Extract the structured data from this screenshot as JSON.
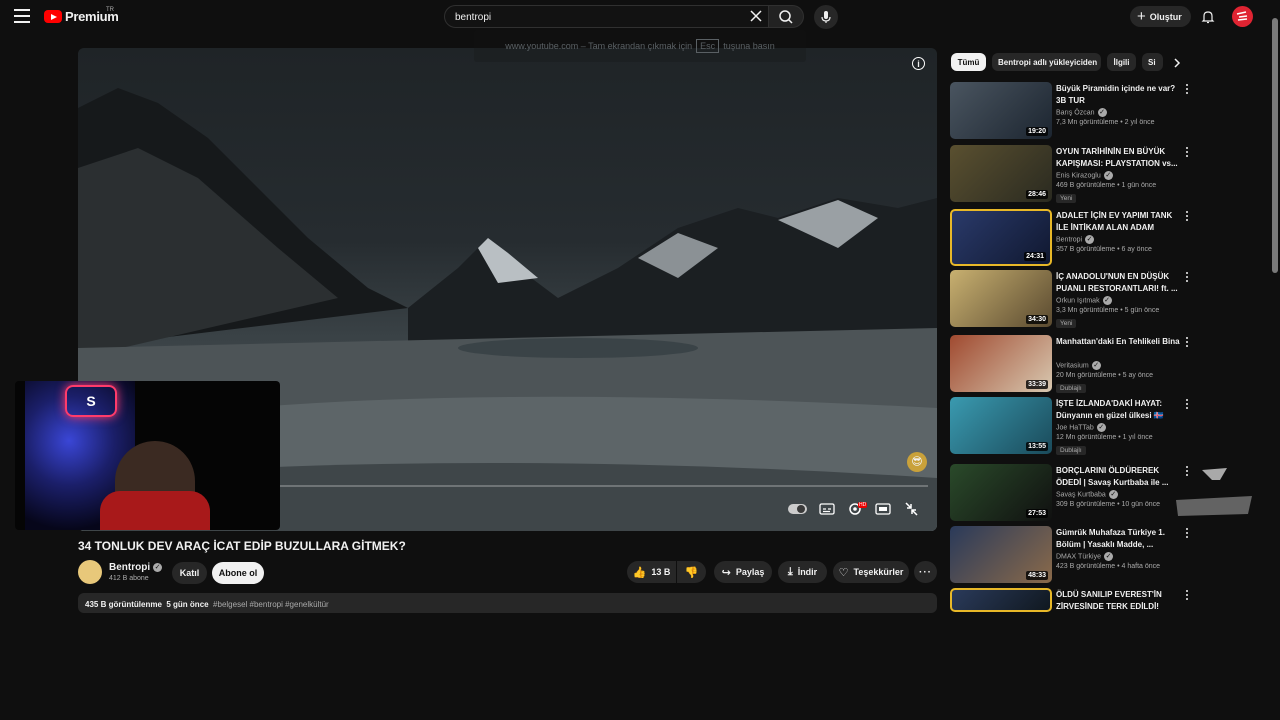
{
  "header": {
    "logo_text": "Premium",
    "country": "TR",
    "search_value": "bentropi",
    "create_label": "Oluştur"
  },
  "player": {
    "fullscreen_hint_before": "www.youtube.com – Tam ekrandan çıkmak için",
    "fullscreen_hint_key": "Esc",
    "fullscreen_hint_after": "tuşuna basın",
    "info_icon": "i",
    "webcam_logo": "S"
  },
  "video": {
    "title": "34 TONLUK DEV ARAÇ İCAT EDİP BUZULLARA GİTMEK?",
    "channel": "Bentropi",
    "subscribers": "412 B abone",
    "join_label": "Katıl",
    "subscribe_label": "Abone ol",
    "likes": "13 B",
    "share_label": "Paylaş",
    "download_label": "İndir",
    "thanks_label": "Teşekkürler",
    "views": "435 B görüntülenme",
    "age": "5 gün önce",
    "tags": "#belgesel #bentropi #genelkültür"
  },
  "chips": [
    "Tümü",
    "Bentropi adlı yükleyiciden",
    "İlgili",
    "Si"
  ],
  "recommendations": [
    {
      "title": "Büyük Piramidin içinde ne var? 3B TUR",
      "channel": "Barış Özcan",
      "views": "7,3 Mn görüntüleme",
      "age": "2 yıl önce",
      "duration": "19:20",
      "badge": "",
      "thumb": [
        "#4a5560",
        "#1c2530"
      ]
    },
    {
      "title": "OYUN TARİHİNİN EN BÜYÜK KAPIŞMASI: PLAYSTATION vs...",
      "channel": "Enis Kirazoglu",
      "views": "469 B görüntüleme",
      "age": "1 gün önce",
      "duration": "28:46",
      "badge": "Yeni",
      "thumb": [
        "#5a5030",
        "#2a2a20"
      ]
    },
    {
      "title": "ADALET İÇİN EV YAPIMI TANK İLE İNTİKAM ALAN ADAM",
      "channel": "Bentropi",
      "views": "357 B görüntüleme",
      "age": "6 ay önce",
      "duration": "24:31",
      "badge": "",
      "thumb": [
        "#2a3a6a",
        "#101830"
      ]
    },
    {
      "title": "İÇ ANADOLU'NUN EN DÜŞÜK PUANLI RESTORANTLARI! ft. ...",
      "channel": "Orkun Işıtmak",
      "views": "3,3 Mn görüntüleme",
      "age": "5 gün önce",
      "duration": "34:30",
      "badge": "Yeni",
      "thumb": [
        "#c8b070",
        "#5a4a30"
      ]
    },
    {
      "title": "Manhattan'daki En Tehlikeli Bina",
      "channel": "Veritasium",
      "views": "20 Mn görüntüleme",
      "age": "5 ay önce",
      "duration": "33:39",
      "badge": "Dublajlı",
      "thumb": [
        "#a04a30",
        "#d8c8b0"
      ]
    },
    {
      "title": "İŞTE İZLANDA'DAKİ HAYAT: Dünyanın en güzel ülkesi 🇮🇸",
      "channel": "Joe HaTTab",
      "views": "12 Mn görüntüleme",
      "age": "1 yıl önce",
      "duration": "13:55",
      "badge": "Dublajlı",
      "thumb": [
        "#3a9ab0",
        "#1a4a5a"
      ]
    },
    {
      "title": "BORÇLARINI ÖLDÜREREK ÖDEDİ | Savaş Kurtbaba ile ...",
      "channel": "Savaş Kurtbaba",
      "views": "309 B görüntüleme",
      "age": "10 gün önce",
      "duration": "27:53",
      "badge": "",
      "thumb": [
        "#2a4a2a",
        "#101010"
      ]
    },
    {
      "title": "Gümrük Muhafaza Türkiye 1. Bölüm | Yasaklı Madde, ...",
      "channel": "DMAX Türkiye",
      "views": "423 B görüntüleme",
      "age": "4 hafta önce",
      "duration": "48:33",
      "badge": "",
      "thumb": [
        "#2a3a5a",
        "#8a6a4a"
      ]
    },
    {
      "title": "ÖLDÜ SANILIP EVEREST'İN ZİRVESİNDE TERK EDİLDİ!",
      "channel": "",
      "views": "",
      "age": "",
      "duration": "",
      "badge": "",
      "thumb": [
        "#2a3a5a",
        "#101820"
      ]
    }
  ]
}
